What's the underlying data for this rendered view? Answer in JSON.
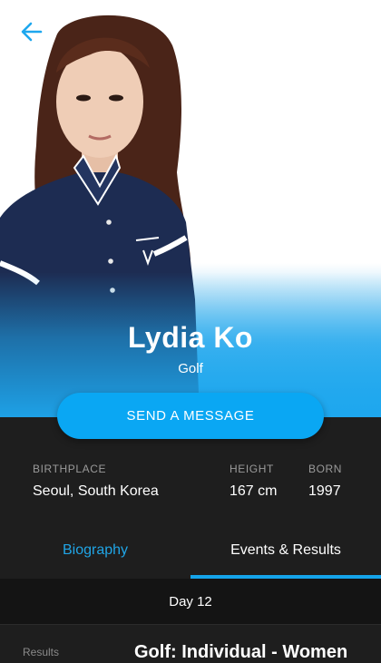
{
  "header": {
    "back_icon": "arrow-left-icon",
    "accent": "#1ea7ee"
  },
  "athlete": {
    "name": "Lydia Ko",
    "sport": "Golf"
  },
  "actions": {
    "send_message_label": "SEND A MESSAGE"
  },
  "facts": [
    {
      "label": "BIRTHPLACE",
      "value": "Seoul, South Korea"
    },
    {
      "label": "HEIGHT",
      "value": "167 cm"
    },
    {
      "label": "BORN",
      "value": "1997"
    }
  ],
  "tabs": [
    {
      "label": "Biography",
      "active": false
    },
    {
      "label": "Events & Results",
      "active": true
    }
  ],
  "schedule": {
    "day_label": "Day 12"
  },
  "results": {
    "column_label": "Results",
    "event_title": "Golf: Individual - Women"
  }
}
